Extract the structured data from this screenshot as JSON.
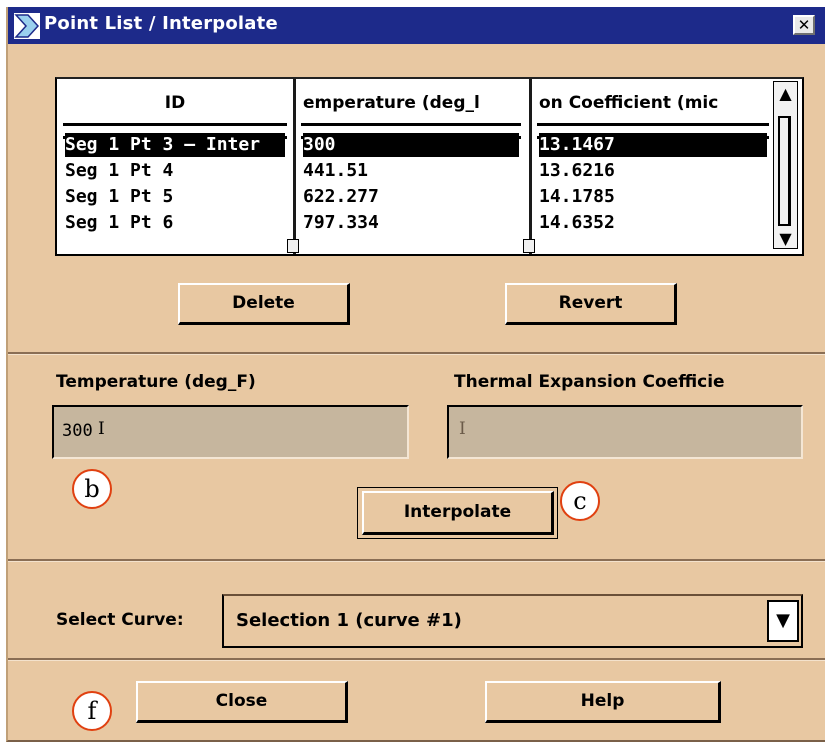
{
  "window": {
    "title": "Point List / Interpolate",
    "close_symbol": "✕"
  },
  "table": {
    "columns": [
      "ID",
      "emperature (deg_l",
      "on Coefficient (mic"
    ],
    "rows": [
      {
        "id": "Seg 1 Pt 3 – Inter",
        "temperature": "300",
        "coefficient": "13.1467",
        "selected": true
      },
      {
        "id": "Seg 1 Pt 4",
        "temperature": "441.51",
        "coefficient": "13.6216",
        "selected": false
      },
      {
        "id": "Seg 1 Pt 5",
        "temperature": "622.277",
        "coefficient": "14.1785",
        "selected": false
      },
      {
        "id": "Seg 1 Pt 6",
        "temperature": "797.334",
        "coefficient": "14.6352",
        "selected": false
      }
    ]
  },
  "buttons": {
    "delete": "Delete",
    "revert": "Revert",
    "interpolate": "Interpolate",
    "close": "Close",
    "help": "Help"
  },
  "fields": {
    "temperature_label": "Temperature (deg_F)",
    "temperature_value": "300",
    "coefficient_label": "Thermal Expansion Coefficie",
    "coefficient_value": ""
  },
  "curve": {
    "label": "Select Curve:",
    "selected": "Selection 1 (curve #1)"
  },
  "annotations": {
    "b": "b",
    "c": "c",
    "f": "f"
  },
  "colors": {
    "titlebar": "#1d2a8a",
    "body": "#e8c8a2",
    "field": "#c6b69e",
    "annotation_ring": "#e04010"
  }
}
